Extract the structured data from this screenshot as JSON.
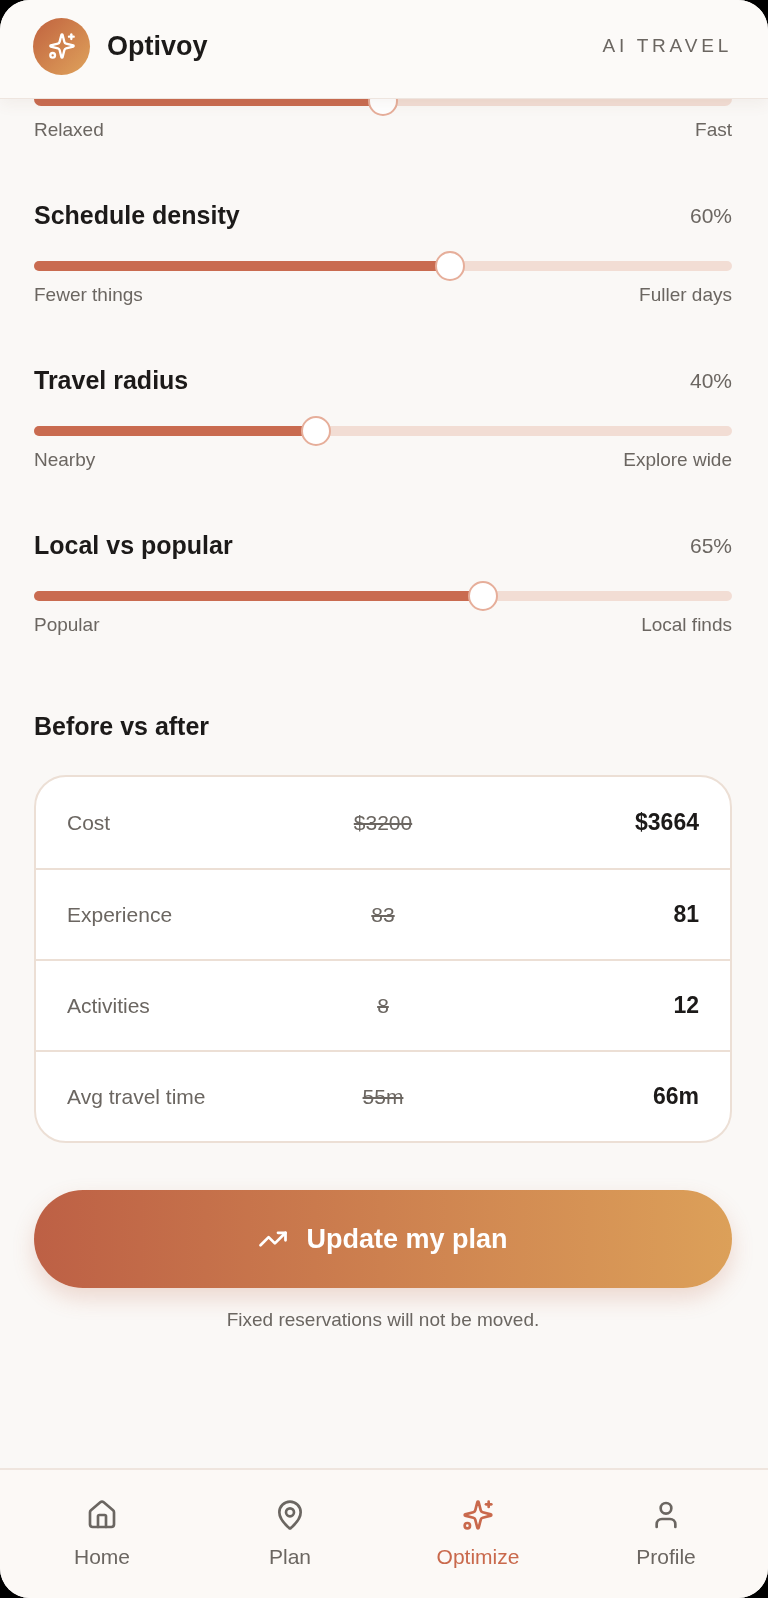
{
  "header": {
    "app_name": "Optivoy",
    "tagline": "AI TRAVEL"
  },
  "sliders": [
    {
      "level": 0.5,
      "low_label": "Relaxed",
      "high_label": "Fast"
    },
    {
      "title": "Schedule density",
      "value": "60%",
      "level": 0.6,
      "low_label": "Fewer things",
      "high_label": "Fuller days"
    },
    {
      "title": "Travel radius",
      "value": "40%",
      "level": 0.4,
      "low_label": "Nearby",
      "high_label": "Explore wide"
    },
    {
      "title": "Local vs popular",
      "value": "65%",
      "level": 0.65,
      "low_label": "Popular",
      "high_label": "Local finds"
    }
  ],
  "comparison": {
    "title": "Before vs after",
    "rows": [
      {
        "label": "Cost",
        "before": "$3200",
        "after": "$3664"
      },
      {
        "label": "Experience",
        "before": "83",
        "after": "81"
      },
      {
        "label": "Activities",
        "before": "8",
        "after": "12"
      },
      {
        "label": "Avg travel time",
        "before": "55m",
        "after": "66m"
      }
    ]
  },
  "update_button": {
    "label": "Update my plan"
  },
  "note": "Fixed reservations will not be moved.",
  "nav": [
    {
      "label": "Home",
      "selected": false
    },
    {
      "label": "Plan",
      "selected": false
    },
    {
      "label": "Optimize",
      "selected": true
    },
    {
      "label": "Profile",
      "selected": false
    }
  ]
}
